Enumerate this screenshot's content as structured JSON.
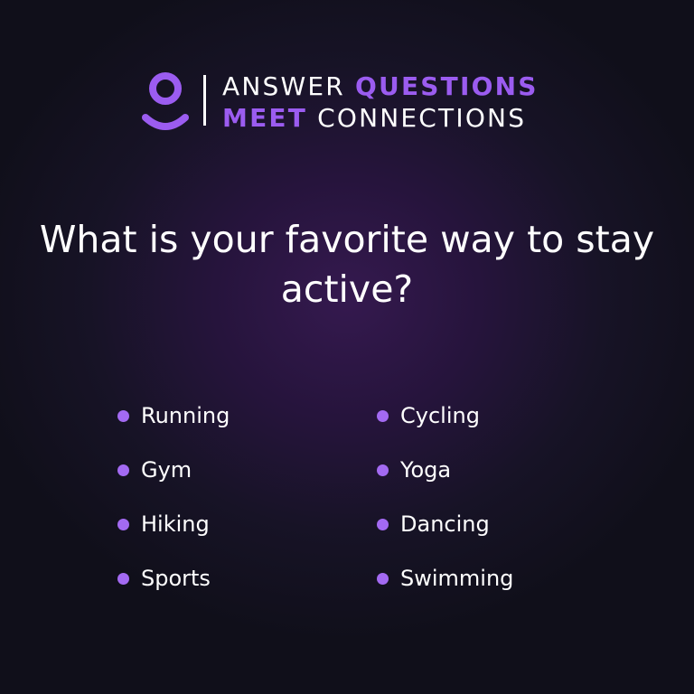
{
  "brand": {
    "icon": "person-icon",
    "accent_color": "#9b5cf0",
    "line1": {
      "light": "ANSWER ",
      "bold": "QUESTIONS"
    },
    "line2": {
      "bold": "MEET",
      "light": " CONNECTIONS"
    }
  },
  "question": "What is your favorite way to stay active?",
  "options": [
    {
      "label": "Running"
    },
    {
      "label": "Gym"
    },
    {
      "label": "Hiking"
    },
    {
      "label": "Sports"
    },
    {
      "label": "Cycling"
    },
    {
      "label": "Yoga"
    },
    {
      "label": "Dancing"
    },
    {
      "label": "Swimming"
    }
  ]
}
